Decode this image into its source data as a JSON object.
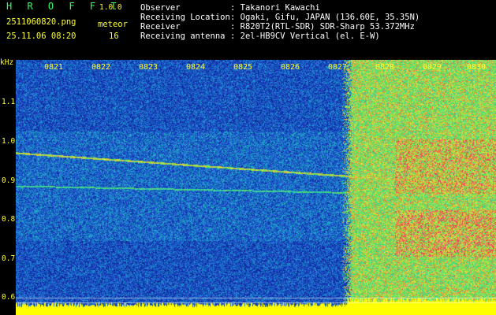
{
  "header": {
    "logo": "H R O F F T",
    "version": "1.0.0",
    "filename": "2511060820.png",
    "meteor_label": "meteor",
    "datetime": "25.11.06 08:20",
    "meteor_count": "16"
  },
  "info": [
    {
      "label": "Observer",
      "value": ": Takanori Kawachi"
    },
    {
      "label": "Receiving Location",
      "value": ": Ogaki, Gifu, JAPAN (136.60E, 35.35N)"
    },
    {
      "label": "Receiver",
      "value": ": R820T2(RTL-SDR) SDR-Sharp 53.372MHz"
    },
    {
      "label": "Receiving antenna",
      "value": ": 2el-HB9CV Vertical (el. E-W)"
    }
  ],
  "axis": {
    "unit": "kHz",
    "y_ticks": [
      "1.1",
      "1.0",
      "0.9",
      "0.8",
      "0.7",
      "0.6"
    ],
    "x_ticks": [
      "0821",
      "0822",
      "0823",
      "0824",
      "0825",
      "0826",
      "0827",
      "0828",
      "0829",
      "0830"
    ]
  },
  "colors": {
    "label_yellow": "#ffff33",
    "logo_green": "#33ff66",
    "background_blue": "#10208a"
  }
}
